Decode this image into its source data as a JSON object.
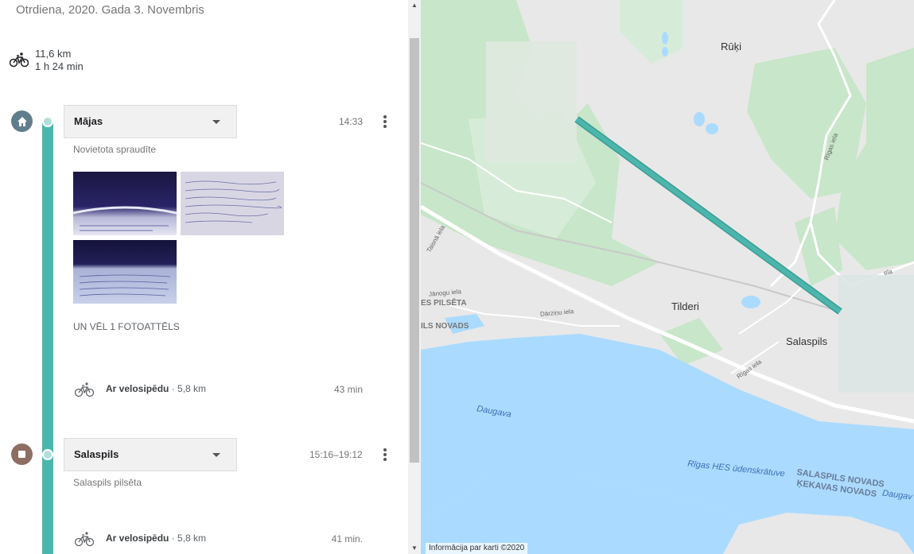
{
  "header": {
    "date": "Otrdiena, 2020. Gada 3. Novembris"
  },
  "summary": {
    "distance": "11,6 km",
    "duration": "1 h 24 min"
  },
  "places": [
    {
      "name": "Mājas",
      "time": "14:33",
      "subtitle": "Novietota spraudīte",
      "icon": "home-icon",
      "color": "#607d8b"
    },
    {
      "name": "Salaspils",
      "time": "15:16–19:12",
      "subtitle": "Salaspils pilsēta",
      "icon": "stop-icon",
      "color": "#8d6e63"
    }
  ],
  "photos": {
    "more_label": "UN VĒL 1 FOTOATTĒLS"
  },
  "activities": [
    {
      "mode": "Ar velosipēdu",
      "distance": "· 5,8 km",
      "duration": "43 min"
    },
    {
      "mode": "Ar velosipēdu",
      "distance": "· 5,8 km",
      "duration": "41 min."
    }
  ],
  "map": {
    "places": {
      "ruki": "Rūķi",
      "tilderi": "Tilderi",
      "salaspils": "Salaspils"
    },
    "roads": {
      "rigas": "Rīgas iela",
      "rigas2": "Rīgas iela",
      "taisna": "Taisnā iela",
      "janogu": "Jānogu iela",
      "darzinu": "Dārziņu iela",
      "ela": "ela"
    },
    "areas": {
      "pilseta": "ES PILSĒTA",
      "novads": "ILS NOVADS"
    },
    "water": {
      "daugava": "Daugava",
      "daugava2": "Daugav",
      "reservoir": "Rīgas HES ūdenskrātuve",
      "border1": "SALASPILS NOVADS",
      "border2": "ĶEKAVAS NOVADS"
    },
    "attribution": "Informācija par karti ©2020",
    "colors": {
      "water": "#aadaff",
      "land": "#e8e8e8",
      "park": "#c8e6c9",
      "route": "#4db6ac"
    }
  }
}
